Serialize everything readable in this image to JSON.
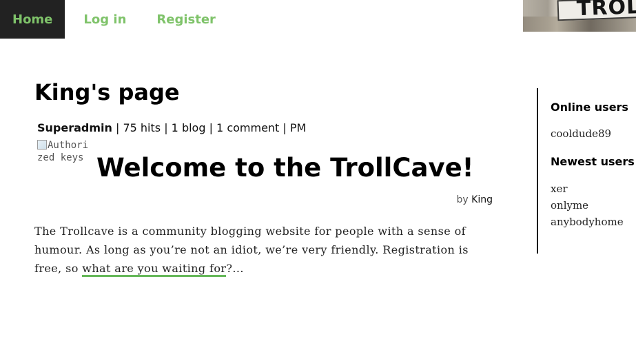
{
  "nav": {
    "items": [
      {
        "label": "Home",
        "active": true
      },
      {
        "label": "Log in",
        "active": false
      },
      {
        "label": "Register",
        "active": false
      }
    ],
    "accent_color": "#7fc36a",
    "active_bg": "#222222"
  },
  "banner": {
    "text": "TROLL"
  },
  "page": {
    "title": "King's page",
    "meta": {
      "author": "Superadmin",
      "hits": "75 hits",
      "blogs": "1 blog",
      "comments": "1 comment",
      "time": "PM",
      "separator": " | "
    }
  },
  "post": {
    "image_alt": "Authorized keys",
    "title": "Welcome to the TrollCave!",
    "byline_prefix": "by",
    "byline_author": "King",
    "excerpt_text": "The Trollcave is a community blogging website for people with a sense of humour. As long as you’re not an idiot, we’re very friendly. Registration is free, so ",
    "excerpt_link": "what are you waiting for",
    "excerpt_suffix": "?...",
    "link_underline_color": "#66b85a"
  },
  "sidebar": {
    "online_heading": "Online users",
    "online_users": [
      "cooldude89"
    ],
    "newest_heading": "Newest users",
    "newest_users": [
      "xer",
      "onlyme",
      "anybodyhome"
    ]
  }
}
